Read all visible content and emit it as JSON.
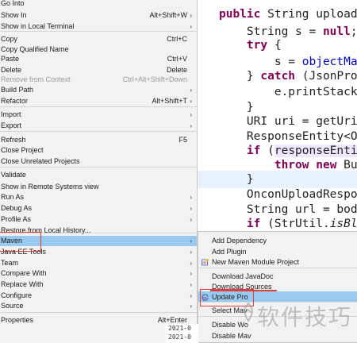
{
  "editor": {
    "lines": [
      {
        "text": "public String upload",
        "kind": "sig"
      },
      {
        "text": "    String s = null;",
        "kind": "decl"
      },
      {
        "text": "    try {",
        "kind": "try"
      },
      {
        "text": "        s = objectMap",
        "kind": "assign"
      },
      {
        "text": "    } catch (JsonProc",
        "kind": "catch"
      },
      {
        "text": "        e.printStackT",
        "kind": "plain"
      },
      {
        "text": "    }",
        "kind": "plain"
      },
      {
        "text": "    URI uri = getUri",
        "kind": "plain"
      },
      {
        "text": "    ResponseEntity<On",
        "kind": "plain"
      },
      {
        "text": "    if (responseEntit",
        "kind": "if"
      },
      {
        "text": "        throw new Bus",
        "kind": "throw"
      },
      {
        "text": "    }",
        "kind": "highlight"
      },
      {
        "text": "    OnconUploadRespo",
        "kind": "plain"
      },
      {
        "text": "    String url = body",
        "kind": "plain"
      },
      {
        "text": "    if (StrUtil.isBl",
        "kind": "partial"
      }
    ]
  },
  "context_menu": {
    "items": [
      {
        "label": "Go Into",
        "shortcut": "",
        "submenu": false,
        "disabled": false
      },
      {
        "label": "Show In",
        "shortcut": "Alt+Shift+W",
        "submenu": true,
        "disabled": false
      },
      {
        "label": "Show in Local Terminal",
        "shortcut": "",
        "submenu": true,
        "disabled": false
      },
      {
        "label": "Copy",
        "shortcut": "Ctrl+C",
        "submenu": false,
        "disabled": false
      },
      {
        "label": "Copy Qualified Name",
        "shortcut": "",
        "submenu": false,
        "disabled": false
      },
      {
        "label": "Paste",
        "shortcut": "Ctrl+V",
        "submenu": false,
        "disabled": false
      },
      {
        "label": "Delete",
        "shortcut": "Delete",
        "submenu": false,
        "disabled": false
      },
      {
        "label": "Remove from Context",
        "shortcut": "Ctrl+Alt+Shift+Down",
        "submenu": false,
        "disabled": true
      },
      {
        "label": "Build Path",
        "shortcut": "",
        "submenu": true,
        "disabled": false
      },
      {
        "label": "Refactor",
        "shortcut": "Alt+Shift+T",
        "submenu": true,
        "disabled": false
      },
      {
        "label": "Import",
        "shortcut": "",
        "submenu": true,
        "disabled": false
      },
      {
        "label": "Export",
        "shortcut": "",
        "submenu": true,
        "disabled": false
      },
      {
        "label": "Refresh",
        "shortcut": "F5",
        "submenu": false,
        "disabled": false
      },
      {
        "label": "Close Project",
        "shortcut": "",
        "submenu": false,
        "disabled": false
      },
      {
        "label": "Close Unrelated Projects",
        "shortcut": "",
        "submenu": false,
        "disabled": false
      },
      {
        "label": "Validate",
        "shortcut": "",
        "submenu": false,
        "disabled": false
      },
      {
        "label": "Show in Remote Systems view",
        "shortcut": "",
        "submenu": false,
        "disabled": false
      },
      {
        "label": "Run As",
        "shortcut": "",
        "submenu": true,
        "disabled": false
      },
      {
        "label": "Debug As",
        "shortcut": "",
        "submenu": true,
        "disabled": false
      },
      {
        "label": "Profile As",
        "shortcut": "",
        "submenu": true,
        "disabled": false
      },
      {
        "label": "Restore from Local History...",
        "shortcut": "",
        "submenu": false,
        "disabled": false
      },
      {
        "label": "Maven",
        "shortcut": "",
        "submenu": true,
        "disabled": false,
        "active": true
      },
      {
        "label": "Java EE Tools",
        "shortcut": "",
        "submenu": true,
        "disabled": false
      },
      {
        "label": "Team",
        "shortcut": "",
        "submenu": true,
        "disabled": false
      },
      {
        "label": "Compare With",
        "shortcut": "",
        "submenu": true,
        "disabled": false
      },
      {
        "label": "Replace With",
        "shortcut": "",
        "submenu": true,
        "disabled": false
      },
      {
        "label": "Configure",
        "shortcut": "",
        "submenu": true,
        "disabled": false
      },
      {
        "label": "Source",
        "shortcut": "",
        "submenu": true,
        "disabled": false
      },
      {
        "label": "Properties",
        "shortcut": "Alt+Enter",
        "submenu": false,
        "disabled": false
      }
    ]
  },
  "maven_submenu": {
    "items": [
      {
        "label": "Add Dependency",
        "icon": ""
      },
      {
        "label": "Add Plugin",
        "icon": ""
      },
      {
        "label": "New Maven Module Project",
        "icon": "maven-module-icon"
      },
      {
        "label": "Download JavaDoc",
        "icon": ""
      },
      {
        "label": "Download Sources",
        "icon": ""
      },
      {
        "label": "Update Pro",
        "icon": "update-project-icon",
        "active": true
      },
      {
        "label": "Select Mav",
        "icon": ""
      },
      {
        "label": "Disable Wo",
        "icon": ""
      },
      {
        "label": "Disable Mav",
        "icon": ""
      }
    ]
  },
  "console": {
    "lines": [
      "2021-0",
      "2021-0"
    ]
  },
  "watermark": {
    "text": "软件技巧"
  },
  "colors": {
    "menu_bg": "#f2f2f2",
    "active_bg": "#99c9ef",
    "highlight_red": "#e23b3b",
    "keyword": "#7f0055",
    "field": "#0000c0"
  },
  "arrow_glyph": "›"
}
